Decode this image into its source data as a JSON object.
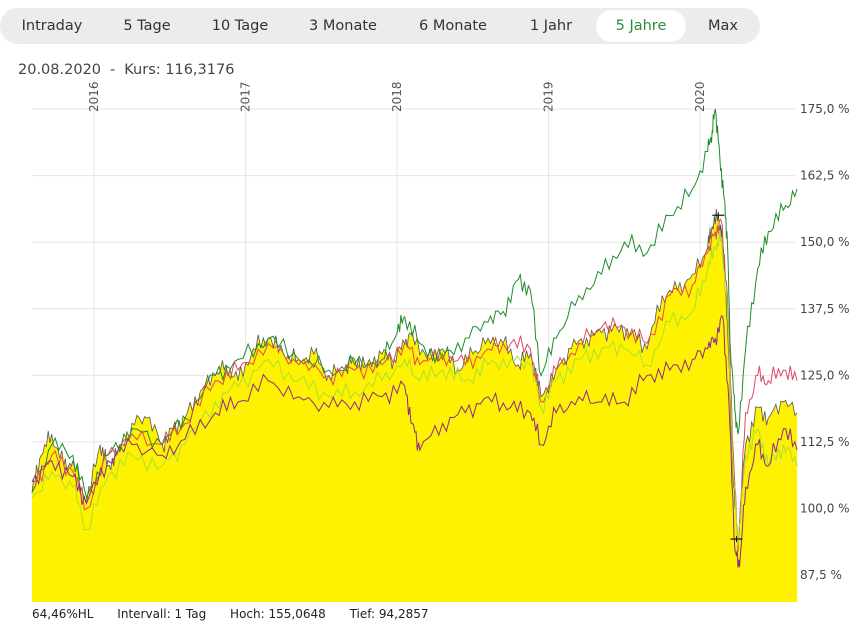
{
  "tabs": [
    {
      "label": "Intraday",
      "active": false
    },
    {
      "label": "5 Tage",
      "active": false
    },
    {
      "label": "10 Tage",
      "active": false
    },
    {
      "label": "3 Monate",
      "active": false
    },
    {
      "label": "6 Monate",
      "active": false
    },
    {
      "label": "1 Jahr",
      "active": false
    },
    {
      "label": "5 Jahre",
      "active": true
    },
    {
      "label": "Max",
      "active": false
    }
  ],
  "info": {
    "date": "20.08.2020",
    "separator": "-",
    "kurs_label": "Kurs: 116,3176"
  },
  "footer": {
    "hl": "64,46%HL",
    "intervall": "Intervall: 1 Tag",
    "hoch": "Hoch: 155,0648",
    "tief": "Tief: 94,2857"
  },
  "colors": {
    "area": "#fff200",
    "green": "#1e8c2a",
    "red": "#e0485a",
    "purple": "#8a2b8a",
    "lime": "#a8e030",
    "tab_active": "#2e8b3a"
  },
  "chart_data": {
    "type": "line",
    "title": "",
    "xlabel": "",
    "ylabel": "",
    "x_ticks": [
      "2016",
      "2017",
      "2018",
      "2019",
      "2020"
    ],
    "y_ticks": [
      "175,0 %",
      "162,5 %",
      "150,0 %",
      "137,5 %",
      "125,0 %",
      "112,5 %",
      "100,0 %",
      "87,5 %"
    ],
    "ylim": [
      84,
      178
    ],
    "xlim": [
      2015.59,
      2020.64
    ],
    "grid": true,
    "marker_labels": {
      "hoch": 155.0648,
      "tief": 94.2857
    },
    "series": [
      {
        "color_key": "area",
        "style": "area",
        "x": [
          2015.59,
          2015.65,
          2015.72,
          2015.8,
          2015.86,
          2015.95,
          2016.04,
          2016.09,
          2016.15,
          2016.25,
          2016.35,
          2016.45,
          2016.52,
          2016.6,
          2016.7,
          2016.8,
          2016.87,
          2016.95,
          2017.05,
          2017.15,
          2017.25,
          2017.35,
          2017.45,
          2017.55,
          2017.65,
          2017.72,
          2017.8,
          2017.9,
          2017.98,
          2018.05,
          2018.1,
          2018.2,
          2018.3,
          2018.4,
          2018.5,
          2018.6,
          2018.7,
          2018.8,
          2018.88,
          2018.95,
          2019.05,
          2019.15,
          2019.25,
          2019.35,
          2019.45,
          2019.55,
          2019.65,
          2019.75,
          2019.85,
          2019.95,
          2020.05,
          2020.08,
          2020.12,
          2020.15,
          2020.18,
          2020.22,
          2020.25,
          2020.3,
          2020.38,
          2020.45,
          2020.55,
          2020.64
        ],
        "values": [
          103,
          110,
          114,
          108,
          109,
          101,
          112,
          108,
          110,
          116,
          117,
          112,
          115,
          117,
          122,
          125,
          127,
          124,
          130,
          132,
          129,
          128,
          129,
          125,
          126,
          128,
          127,
          129,
          128,
          131,
          133,
          128,
          130,
          126,
          129,
          132,
          131,
          127,
          129,
          121,
          126,
          130,
          132,
          133,
          134,
          133,
          130,
          140,
          141,
          144,
          149,
          153,
          155,
          150,
          135,
          104,
          94.3,
          112,
          119,
          117,
          120,
          118
        ]
      },
      {
        "color_key": "green",
        "style": "line",
        "x": [
          2015.59,
          2015.72,
          2015.86,
          2015.95,
          2016.09,
          2016.25,
          2016.45,
          2016.6,
          2016.8,
          2016.95,
          2017.15,
          2017.35,
          2017.55,
          2017.72,
          2017.9,
          2018.0,
          2018.05,
          2018.15,
          2018.3,
          2018.45,
          2018.6,
          2018.7,
          2018.8,
          2018.88,
          2018.95,
          2019.05,
          2019.2,
          2019.35,
          2019.5,
          2019.65,
          2019.8,
          2019.95,
          2020.05,
          2020.08,
          2020.1,
          2020.13,
          2020.16,
          2020.18,
          2020.2,
          2020.23,
          2020.25,
          2020.3,
          2020.38,
          2020.45,
          2020.55,
          2020.64
        ],
        "values": [
          103,
          112,
          110,
          102,
          110,
          115,
          112,
          117,
          125,
          128,
          132,
          128,
          126,
          127,
          128,
          133,
          136,
          131,
          128,
          132,
          135,
          137,
          143,
          141,
          125,
          132,
          140,
          144,
          150,
          148,
          155,
          160,
          167,
          171,
          175,
          166,
          158,
          150,
          130,
          118,
          114,
          130,
          145,
          152,
          156,
          160
        ]
      },
      {
        "color_key": "red",
        "style": "line",
        "x": [
          2015.59,
          2015.72,
          2015.86,
          2015.95,
          2016.09,
          2016.25,
          2016.45,
          2016.6,
          2016.8,
          2016.95,
          2017.15,
          2017.35,
          2017.55,
          2017.72,
          2017.9,
          2018.05,
          2018.15,
          2018.3,
          2018.45,
          2018.6,
          2018.75,
          2018.88,
          2018.95,
          2019.05,
          2019.2,
          2019.35,
          2019.5,
          2019.65,
          2019.8,
          2019.95,
          2020.05,
          2020.1,
          2020.14,
          2020.18,
          2020.22,
          2020.25,
          2020.3,
          2020.38,
          2020.45,
          2020.55,
          2020.64
        ],
        "values": [
          104,
          110,
          107,
          100,
          110,
          114,
          112,
          116,
          124,
          126,
          131,
          127,
          125,
          126,
          127,
          131,
          127,
          129,
          127,
          130,
          131,
          130,
          120,
          126,
          131,
          134,
          134,
          131,
          140,
          142,
          148,
          152,
          154,
          140,
          110,
          92,
          118,
          125,
          124,
          126,
          124
        ]
      },
      {
        "color_key": "lime",
        "style": "line",
        "x": [
          2015.59,
          2015.72,
          2015.86,
          2015.95,
          2016.09,
          2016.25,
          2016.45,
          2016.6,
          2016.8,
          2016.95,
          2017.15,
          2017.35,
          2017.55,
          2017.72,
          2017.9,
          2018.05,
          2018.15,
          2018.3,
          2018.45,
          2018.6,
          2018.75,
          2018.88,
          2018.95,
          2019.05,
          2019.2,
          2019.35,
          2019.5,
          2019.65,
          2019.8,
          2019.95,
          2020.05,
          2020.1,
          2020.14,
          2020.18,
          2020.22,
          2020.25,
          2020.3,
          2020.38,
          2020.45,
          2020.55,
          2020.64
        ],
        "values": [
          102,
          107,
          104,
          96,
          106,
          110,
          108,
          112,
          120,
          123,
          128,
          124,
          121,
          122,
          124,
          128,
          124,
          126,
          124,
          127,
          128,
          127,
          119,
          124,
          128,
          130,
          130,
          127,
          135,
          137,
          145,
          149,
          151,
          137,
          107,
          93,
          110,
          115,
          108,
          112,
          108
        ]
      },
      {
        "color_key": "purple",
        "style": "line",
        "x": [
          2015.59,
          2015.72,
          2015.86,
          2015.95,
          2016.09,
          2016.25,
          2016.45,
          2016.6,
          2016.8,
          2016.95,
          2017.15,
          2017.35,
          2017.55,
          2017.72,
          2017.9,
          2018.05,
          2018.1,
          2018.15,
          2018.3,
          2018.45,
          2018.6,
          2018.75,
          2018.88,
          2018.95,
          2019.05,
          2019.2,
          2019.35,
          2019.5,
          2019.65,
          2019.8,
          2019.95,
          2020.05,
          2020.1,
          2020.15,
          2020.19,
          2020.23,
          2020.26,
          2020.3,
          2020.38,
          2020.45,
          2020.55,
          2020.64
        ],
        "values": [
          105,
          109,
          106,
          101,
          109,
          112,
          110,
          113,
          118,
          120,
          124,
          121,
          119,
          120,
          121,
          123,
          116,
          111,
          116,
          118,
          121,
          119,
          118,
          112,
          118,
          121,
          120,
          120,
          125,
          126,
          128,
          130,
          132,
          136,
          120,
          92,
          89,
          104,
          112,
          108,
          115,
          111
        ]
      }
    ]
  }
}
